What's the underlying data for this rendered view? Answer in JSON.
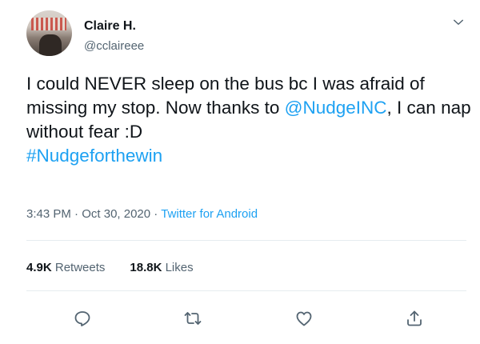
{
  "author": {
    "name": "Claire H.",
    "handle": "@cclaireee"
  },
  "tweet": {
    "line1": "I could NEVER sleep on the bus bc I was afraid of missing my stop. Now thanks to ",
    "mention": "@NudgeINC",
    "line2": ", I can nap without fear :D",
    "hashtag": "#Nudgeforthewin"
  },
  "meta": {
    "time": "3:43 PM",
    "separator1": " · ",
    "date": "Oct 30, 2020",
    "separator2": " · ",
    "source": "Twitter for Android"
  },
  "stats": {
    "retweets_count": "4.9K",
    "retweets_label": "Retweets",
    "likes_count": "18.8K",
    "likes_label": "Likes"
  },
  "icons": {
    "caret": "chevron-down-icon",
    "reply": "reply-icon",
    "retweet": "retweet-icon",
    "like": "heart-icon",
    "share": "share-icon"
  },
  "colors": {
    "accent": "#1da1f2",
    "text": "#0f1419",
    "muted": "#536471",
    "divider": "#e6ecf0"
  }
}
